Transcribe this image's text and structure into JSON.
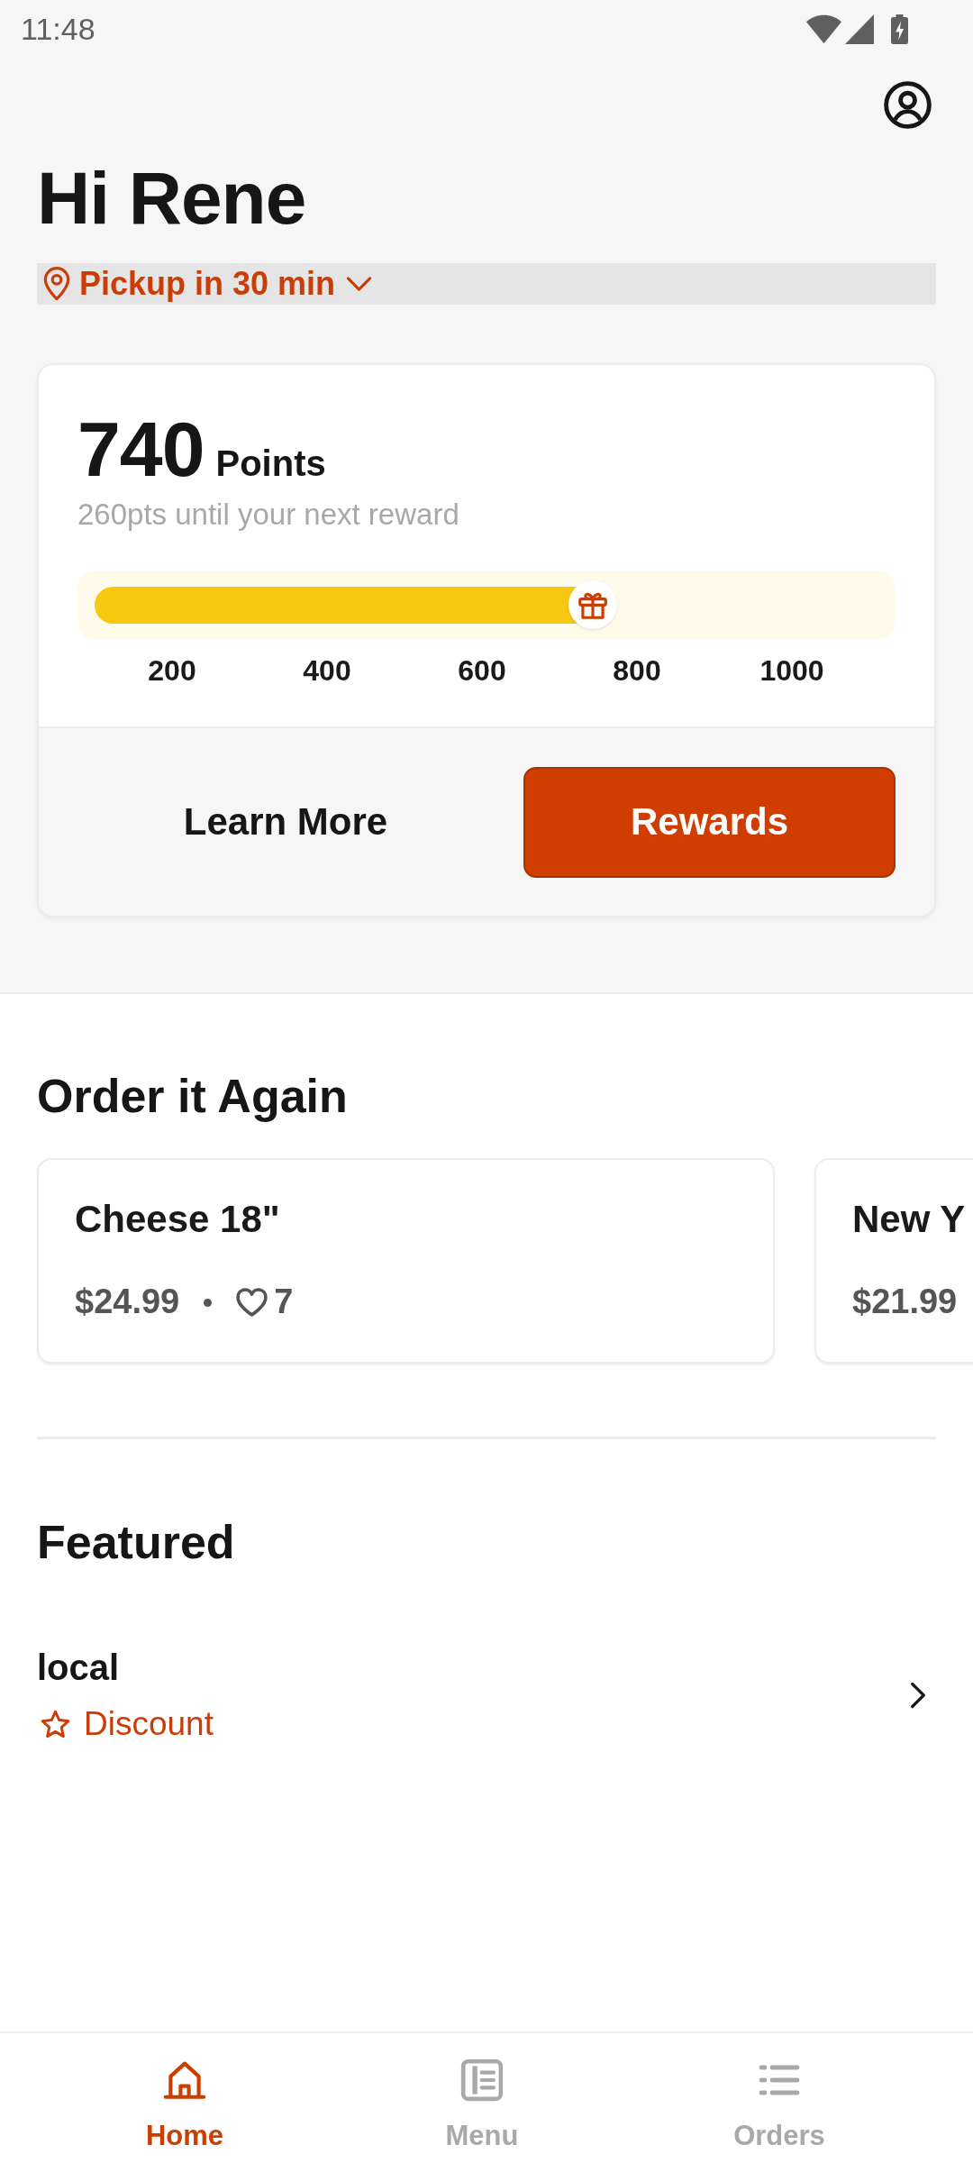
{
  "status_bar": {
    "time": "11:48"
  },
  "header": {
    "greeting": "Hi Rene",
    "pickup": "Pickup in 30 min"
  },
  "points_card": {
    "points": "740",
    "unit": "Points",
    "subtitle": "260pts until your next reward",
    "progress": {
      "level": 0.63
    },
    "ticks": [
      "200",
      "400",
      "600",
      "800",
      "1000"
    ],
    "buttons": [
      {
        "label": "Learn More",
        "kind": "text"
      },
      {
        "label": "Rewards",
        "kind": "primary"
      }
    ]
  },
  "order_again": {
    "title": "Order it Again",
    "items": [
      {
        "name": "Cheese 18\"",
        "price": "$24.99",
        "likes": "7"
      },
      {
        "name": "New Y",
        "price": "$21.99"
      }
    ]
  },
  "featured": {
    "title": "Featured",
    "items": [
      {
        "name": "local",
        "tag": "Discount"
      }
    ]
  },
  "nav": [
    {
      "label": "Home",
      "kind": "home",
      "selected": true
    },
    {
      "label": "Menu",
      "kind": "menu",
      "selected": false
    },
    {
      "label": "Orders",
      "kind": "orders",
      "selected": false
    }
  ]
}
